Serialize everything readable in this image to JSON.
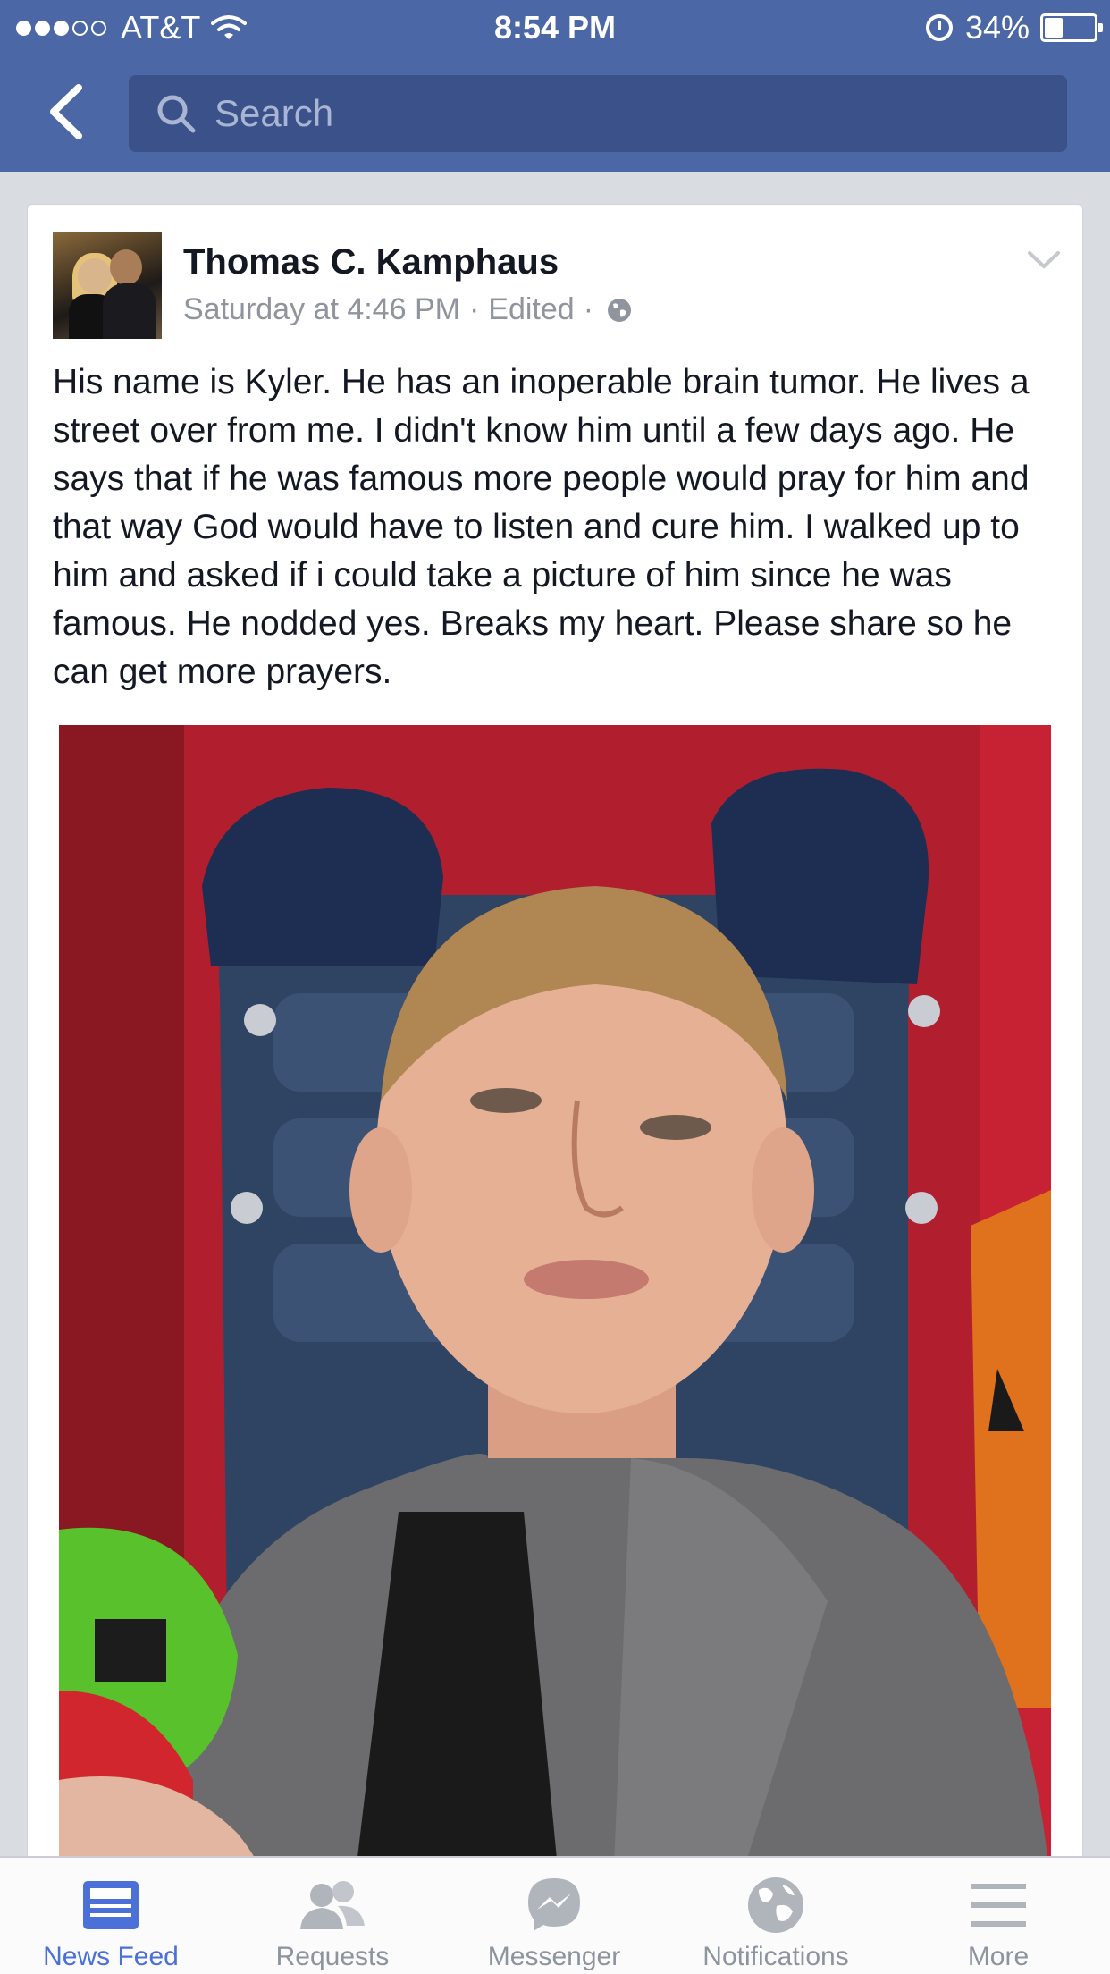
{
  "status_bar": {
    "carrier": "AT&T",
    "signal_bars_filled": 3,
    "signal_bars_total": 5,
    "time": "8:54 PM",
    "battery_percent": "34%",
    "battery_level": 0.34
  },
  "nav": {
    "search_placeholder": "Search"
  },
  "post": {
    "author": "Thomas C. Kamphaus",
    "timestamp": "Saturday at 4:46 PM",
    "edited": "Edited",
    "separator": "·",
    "text": "His name is Kyler. He has an inoperable brain tumor. He lives a street over from me. I didn't know him until a few days ago. He says that if he was famous more people would pray for him and that way God would have to listen and cure him. I walked up to him and asked if i could take a picture of him since he was famous. He nodded yes. Breaks my heart. Please share so he can get more prayers.",
    "privacy_icon": "globe-icon"
  },
  "tabs": [
    {
      "label": "News Feed",
      "icon": "news-feed-icon",
      "active": true
    },
    {
      "label": "Requests",
      "icon": "requests-icon",
      "active": false
    },
    {
      "label": "Messenger",
      "icon": "messenger-icon",
      "active": false
    },
    {
      "label": "Notifications",
      "icon": "globe-icon",
      "active": false
    },
    {
      "label": "More",
      "icon": "menu-icon",
      "active": false
    }
  ],
  "colors": {
    "header": "#4b67a6",
    "search_bg": "#3a5289",
    "active_tab": "#4b70d8",
    "inactive_tab": "#8d949e"
  }
}
